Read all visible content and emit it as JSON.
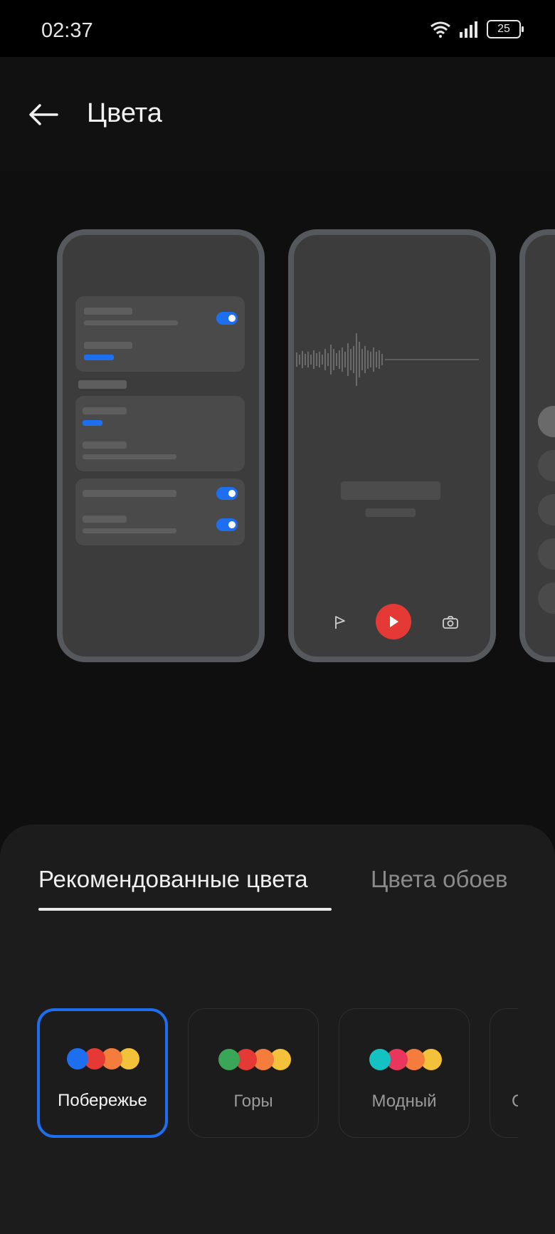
{
  "status_bar": {
    "time": "02:37",
    "battery": "25"
  },
  "header": {
    "title": "Цвета"
  },
  "tabs": [
    {
      "label": "Рекомендованные цвета",
      "active": true
    },
    {
      "label": "Цвета обоев",
      "active": false
    }
  ],
  "themes": [
    {
      "label": "Побережье",
      "selected": true,
      "colors": [
        "#1e6ff0",
        "#e53935",
        "#f47c3c",
        "#f4c23a"
      ]
    },
    {
      "label": "Горы",
      "selected": false,
      "colors": [
        "#3aa657",
        "#e53935",
        "#f47c3c",
        "#f4c23a"
      ]
    },
    {
      "label": "Модный",
      "selected": false,
      "colors": [
        "#14c2c2",
        "#e8365d",
        "#f47c3c",
        "#f4c23a"
      ]
    },
    {
      "label": "С",
      "selected": false,
      "colors": []
    }
  ],
  "colors": {
    "accent": "#1e6ff0",
    "play": "#e53935"
  }
}
